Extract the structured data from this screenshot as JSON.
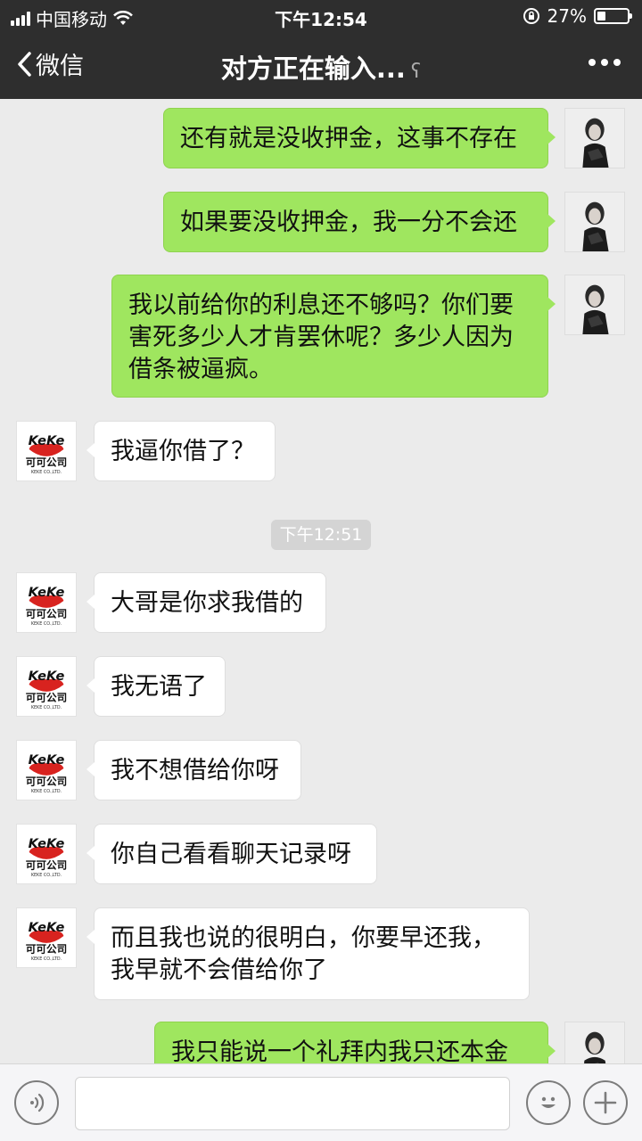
{
  "status_bar": {
    "carrier": "中国移动",
    "time": "下午12:54",
    "battery_percent": "27%",
    "battery_level": 0.27
  },
  "nav": {
    "back_label": "微信",
    "title": "对方正在输入..."
  },
  "chat": {
    "timestamp": "下午12:51",
    "keke_logo_text": "KeKe",
    "keke_logo_cn": "可可公司",
    "keke_logo_sub": "KEKE CO.,LTD.",
    "messages": [
      {
        "sender": "me",
        "text": "还有就是没收押金，这事不存在"
      },
      {
        "sender": "me",
        "text": "如果要没收押金，我一分不会还"
      },
      {
        "sender": "me",
        "text": "我以前给你的利息还不够吗？你们要害死多少人才肯罢休呢？多少人因为借条被逼疯。"
      },
      {
        "sender": "other",
        "text": "我逼你借了？"
      },
      {
        "sender": "other",
        "text": "大哥是你求我借的"
      },
      {
        "sender": "other",
        "text": "我无语了"
      },
      {
        "sender": "other",
        "text": "我不想借给你呀"
      },
      {
        "sender": "other",
        "text": "你自己看看聊天记录呀"
      },
      {
        "sender": "other",
        "text": "而且我也说的很明白，你要早还我，我早就不会借给你了"
      },
      {
        "sender": "me",
        "text": "我只能说一个礼拜内我只还本金"
      }
    ]
  },
  "input_bar": {
    "voice_icon": "voice-icon",
    "emoji_icon": "emoji-icon",
    "plus_icon": "plus-icon"
  }
}
